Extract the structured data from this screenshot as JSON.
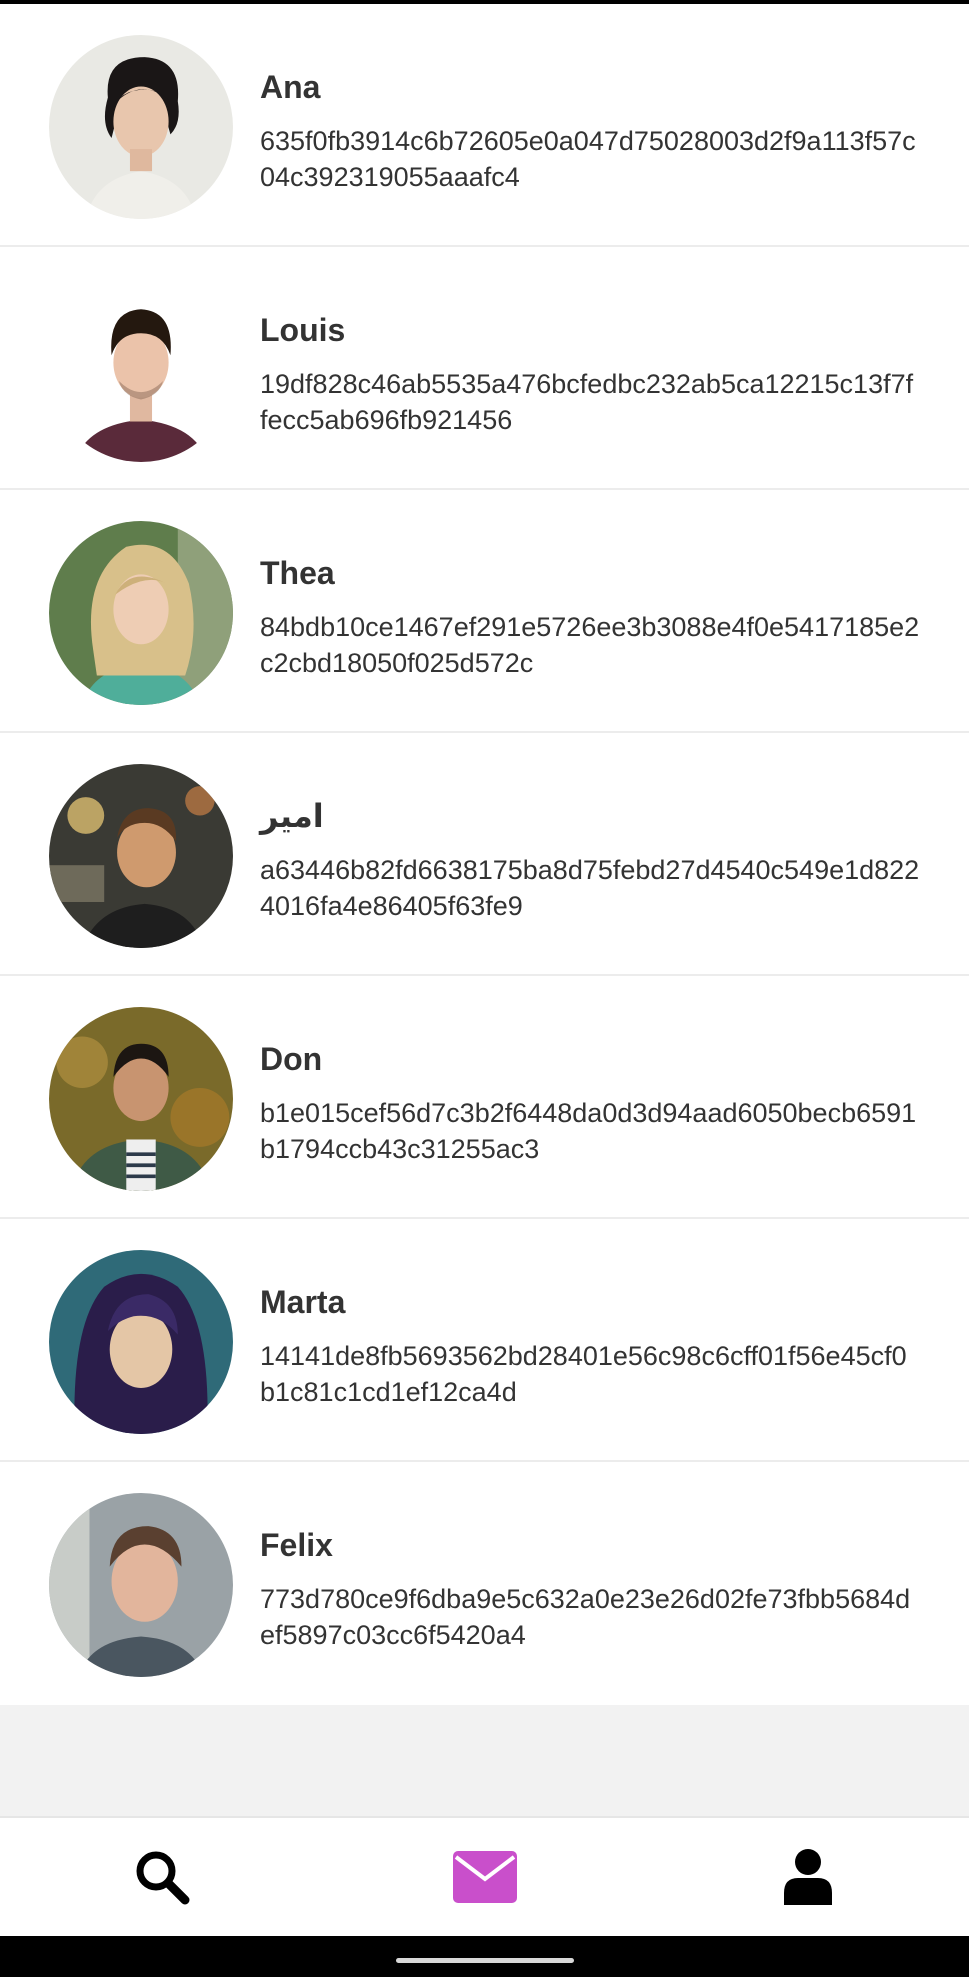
{
  "contacts": [
    {
      "name": "Ana",
      "key": "635f0fb3914c6b72605e0a047d75028003d2f9a113f57c04c392319055aaafc4"
    },
    {
      "name": "Louis",
      "key": "19df828c46ab5535a476bcfedbc232ab5ca12215c13f7ffecc5ab696fb921456"
    },
    {
      "name": "Thea",
      "key": "84bdb10ce1467ef291e5726ee3b3088e4f0e5417185e2c2cbd18050f025d572c"
    },
    {
      "name": "امیر",
      "key": "a63446b82fd6638175ba8d75febd27d4540c549e1d8224016fa4e86405f63fe9"
    },
    {
      "name": "Don",
      "key": "b1e015cef56d7c3b2f6448da0d3d94aad6050becb6591b1794ccb43c31255ac3"
    },
    {
      "name": "Marta",
      "key": "14141de8fb5693562bd28401e56c98c6cff01f56e45cf0b1c81c1cd1ef12ca4d"
    },
    {
      "name": "Felix",
      "key": "773d780ce9f6dba9e5c632a0e23e26d02fe73fbb5684def5897c03cc6f5420a4"
    }
  ],
  "bottom_nav": {
    "items": [
      {
        "icon": "search-icon",
        "color": "#000000"
      },
      {
        "icon": "envelope-icon",
        "color": "#c94fcb",
        "active": true
      },
      {
        "icon": "user-icon",
        "color": "#000000"
      }
    ]
  }
}
